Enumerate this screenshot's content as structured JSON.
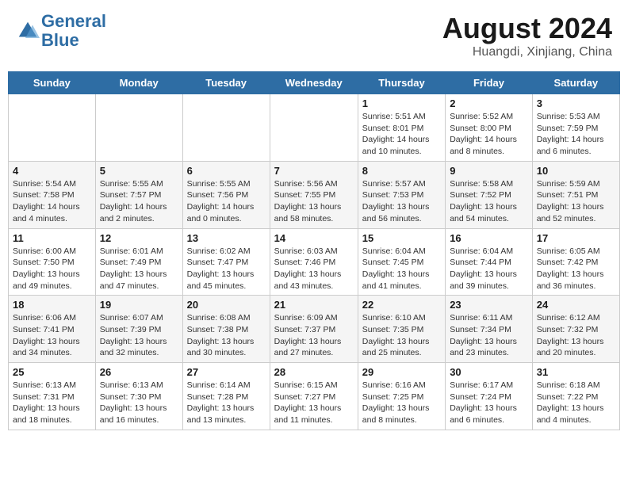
{
  "header": {
    "logo_line1": "General",
    "logo_line2": "Blue",
    "month": "August 2024",
    "location": "Huangdi, Xinjiang, China"
  },
  "calendar": {
    "weekdays": [
      "Sunday",
      "Monday",
      "Tuesday",
      "Wednesday",
      "Thursday",
      "Friday",
      "Saturday"
    ],
    "weeks": [
      [
        {
          "day": "",
          "info": ""
        },
        {
          "day": "",
          "info": ""
        },
        {
          "day": "",
          "info": ""
        },
        {
          "day": "",
          "info": ""
        },
        {
          "day": "1",
          "info": "Sunrise: 5:51 AM\nSunset: 8:01 PM\nDaylight: 14 hours\nand 10 minutes."
        },
        {
          "day": "2",
          "info": "Sunrise: 5:52 AM\nSunset: 8:00 PM\nDaylight: 14 hours\nand 8 minutes."
        },
        {
          "day": "3",
          "info": "Sunrise: 5:53 AM\nSunset: 7:59 PM\nDaylight: 14 hours\nand 6 minutes."
        }
      ],
      [
        {
          "day": "4",
          "info": "Sunrise: 5:54 AM\nSunset: 7:58 PM\nDaylight: 14 hours\nand 4 minutes."
        },
        {
          "day": "5",
          "info": "Sunrise: 5:55 AM\nSunset: 7:57 PM\nDaylight: 14 hours\nand 2 minutes."
        },
        {
          "day": "6",
          "info": "Sunrise: 5:55 AM\nSunset: 7:56 PM\nDaylight: 14 hours\nand 0 minutes."
        },
        {
          "day": "7",
          "info": "Sunrise: 5:56 AM\nSunset: 7:55 PM\nDaylight: 13 hours\nand 58 minutes."
        },
        {
          "day": "8",
          "info": "Sunrise: 5:57 AM\nSunset: 7:53 PM\nDaylight: 13 hours\nand 56 minutes."
        },
        {
          "day": "9",
          "info": "Sunrise: 5:58 AM\nSunset: 7:52 PM\nDaylight: 13 hours\nand 54 minutes."
        },
        {
          "day": "10",
          "info": "Sunrise: 5:59 AM\nSunset: 7:51 PM\nDaylight: 13 hours\nand 52 minutes."
        }
      ],
      [
        {
          "day": "11",
          "info": "Sunrise: 6:00 AM\nSunset: 7:50 PM\nDaylight: 13 hours\nand 49 minutes."
        },
        {
          "day": "12",
          "info": "Sunrise: 6:01 AM\nSunset: 7:49 PM\nDaylight: 13 hours\nand 47 minutes."
        },
        {
          "day": "13",
          "info": "Sunrise: 6:02 AM\nSunset: 7:47 PM\nDaylight: 13 hours\nand 45 minutes."
        },
        {
          "day": "14",
          "info": "Sunrise: 6:03 AM\nSunset: 7:46 PM\nDaylight: 13 hours\nand 43 minutes."
        },
        {
          "day": "15",
          "info": "Sunrise: 6:04 AM\nSunset: 7:45 PM\nDaylight: 13 hours\nand 41 minutes."
        },
        {
          "day": "16",
          "info": "Sunrise: 6:04 AM\nSunset: 7:44 PM\nDaylight: 13 hours\nand 39 minutes."
        },
        {
          "day": "17",
          "info": "Sunrise: 6:05 AM\nSunset: 7:42 PM\nDaylight: 13 hours\nand 36 minutes."
        }
      ],
      [
        {
          "day": "18",
          "info": "Sunrise: 6:06 AM\nSunset: 7:41 PM\nDaylight: 13 hours\nand 34 minutes."
        },
        {
          "day": "19",
          "info": "Sunrise: 6:07 AM\nSunset: 7:39 PM\nDaylight: 13 hours\nand 32 minutes."
        },
        {
          "day": "20",
          "info": "Sunrise: 6:08 AM\nSunset: 7:38 PM\nDaylight: 13 hours\nand 30 minutes."
        },
        {
          "day": "21",
          "info": "Sunrise: 6:09 AM\nSunset: 7:37 PM\nDaylight: 13 hours\nand 27 minutes."
        },
        {
          "day": "22",
          "info": "Sunrise: 6:10 AM\nSunset: 7:35 PM\nDaylight: 13 hours\nand 25 minutes."
        },
        {
          "day": "23",
          "info": "Sunrise: 6:11 AM\nSunset: 7:34 PM\nDaylight: 13 hours\nand 23 minutes."
        },
        {
          "day": "24",
          "info": "Sunrise: 6:12 AM\nSunset: 7:32 PM\nDaylight: 13 hours\nand 20 minutes."
        }
      ],
      [
        {
          "day": "25",
          "info": "Sunrise: 6:13 AM\nSunset: 7:31 PM\nDaylight: 13 hours\nand 18 minutes."
        },
        {
          "day": "26",
          "info": "Sunrise: 6:13 AM\nSunset: 7:30 PM\nDaylight: 13 hours\nand 16 minutes."
        },
        {
          "day": "27",
          "info": "Sunrise: 6:14 AM\nSunset: 7:28 PM\nDaylight: 13 hours\nand 13 minutes."
        },
        {
          "day": "28",
          "info": "Sunrise: 6:15 AM\nSunset: 7:27 PM\nDaylight: 13 hours\nand 11 minutes."
        },
        {
          "day": "29",
          "info": "Sunrise: 6:16 AM\nSunset: 7:25 PM\nDaylight: 13 hours\nand 8 minutes."
        },
        {
          "day": "30",
          "info": "Sunrise: 6:17 AM\nSunset: 7:24 PM\nDaylight: 13 hours\nand 6 minutes."
        },
        {
          "day": "31",
          "info": "Sunrise: 6:18 AM\nSunset: 7:22 PM\nDaylight: 13 hours\nand 4 minutes."
        }
      ]
    ]
  }
}
